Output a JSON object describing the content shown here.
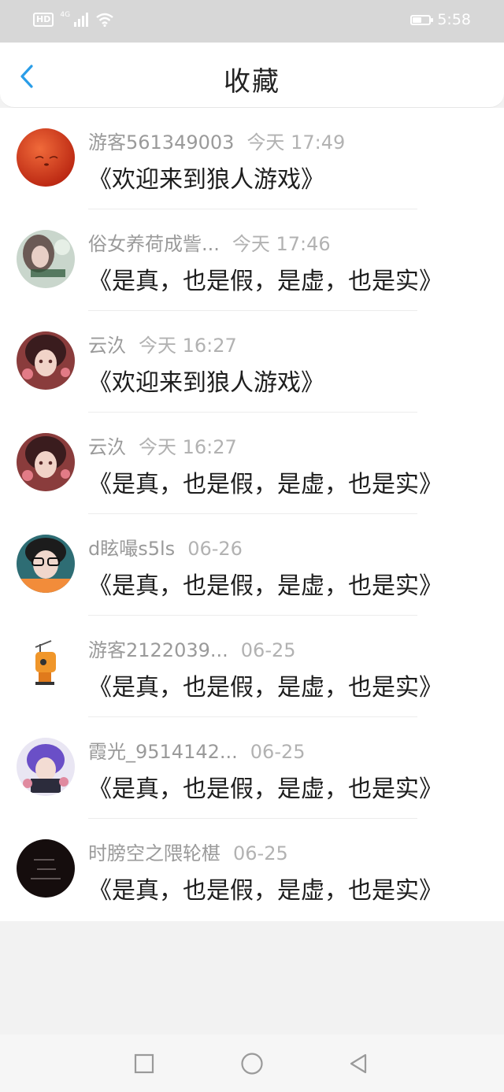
{
  "status_bar": {
    "hd_label": "HD",
    "network": "4G",
    "time": "5:58",
    "battery_level": 0.55
  },
  "header": {
    "back_icon": "chevron-left-icon",
    "title": "收藏"
  },
  "favorites": [
    {
      "user": "游客561349003",
      "time": "今天 17:49",
      "text": "《欢迎来到狼人游戏》"
    },
    {
      "user": "俗女养荷成訾...",
      "time": "今天 17:46",
      "text": "《是真，也是假，是虚，也是实》"
    },
    {
      "user": "云汣",
      "time": "今天 16:27",
      "text": "《欢迎来到狼人游戏》"
    },
    {
      "user": "云汣",
      "time": "今天 16:27",
      "text": "《是真，也是假，是虚，也是实》"
    },
    {
      "user": "d眩嘬s5ls",
      "time": "06-26",
      "text": "《是真，也是假，是虚，也是实》"
    },
    {
      "user": "游客2122039...",
      "time": "06-25",
      "text": "《是真，也是假，是虚，也是实》"
    },
    {
      "user": "霞光_9514142...",
      "time": "06-25",
      "text": "《是真，也是假，是虚，也是实》"
    },
    {
      "user": "时膀空之隈轮椹",
      "time": "06-25",
      "text": "《是真，也是假，是虚，也是实》"
    }
  ],
  "system_nav": {
    "recent_icon": "square-icon",
    "home_icon": "circle-icon",
    "back_icon": "triangle-back-icon"
  },
  "colors": {
    "accent": "#2a9de8",
    "status_bar": "#d7d7d7"
  }
}
